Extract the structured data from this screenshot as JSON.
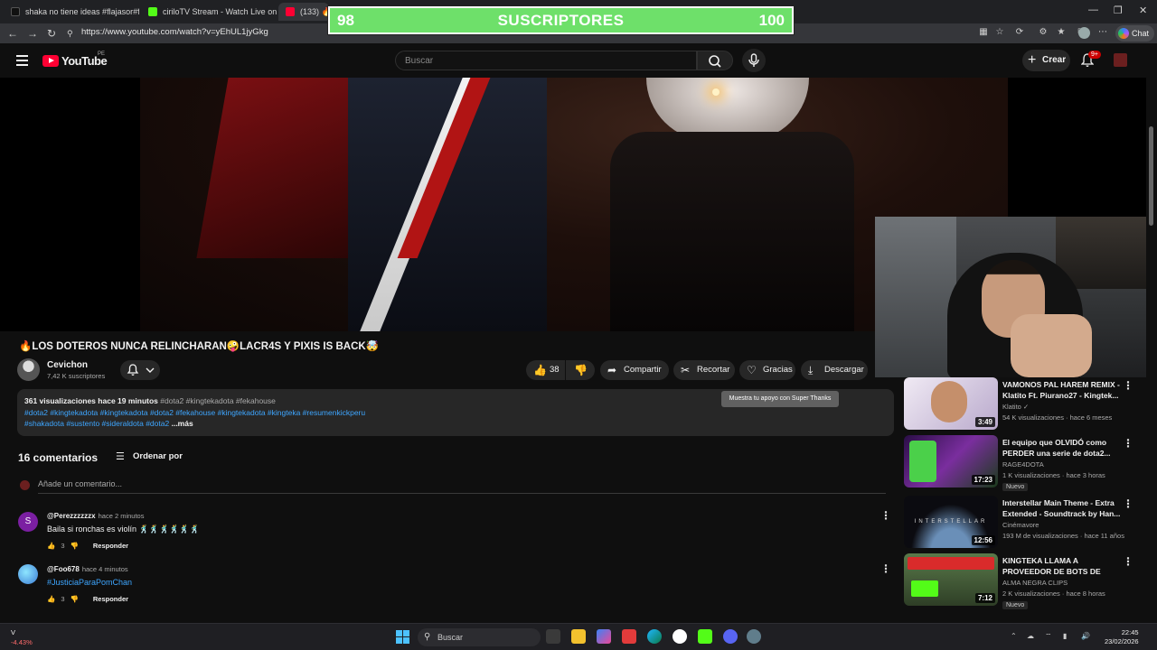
{
  "browser": {
    "tabs": [
      {
        "label": "shaka no tiene ideas #flajasor#fek",
        "color": "#000000"
      },
      {
        "label": "ciriloTV Stream - Watch Live on Ki",
        "color": "#53fc18"
      },
      {
        "label": "(133) 🔥LO",
        "color": "#ff0033"
      }
    ],
    "url": "https://www.youtube.com/watch?v=yEhUL1jyGkg",
    "chat_label": "Chat"
  },
  "sub_overlay": {
    "current": "98",
    "label": "SUSCRIPTORES",
    "goal": "100"
  },
  "youtube_header": {
    "logo_text": "YouTube",
    "region": "PE",
    "search_placeholder": "Buscar",
    "create_label": "Crear",
    "notif_count": "9+"
  },
  "video": {
    "title": "🔥LOS DOTEROS NUNCA RELINCHARAN🤪LACR4S Y PIXIS IS BACK🤯",
    "channel_name": "Cevichon",
    "channel_subs": "7,42 K suscriptores",
    "likes": "38",
    "actions": {
      "share": "Compartir",
      "clip": "Recortar",
      "thanks": "Gracias",
      "download": "Descargar"
    },
    "tooltip": "Muestra tu apoyo con Super Thanks"
  },
  "description": {
    "views": "361 visualizaciones",
    "time": "hace 19 minutos",
    "top_tags": "#dota2 #kingtekadota #fekahouse",
    "line2": "#dota2 #kingtekadota #kingtekadota #dota2 #fekahouse #kingtekadota #kingteka  #resumenkickperu",
    "line3": "#shakadota #sustento #sideraldota #dota2",
    "more": "...más"
  },
  "comments": {
    "count_label": "16 comentarios",
    "sort_label": "Ordenar por",
    "add_placeholder": "Añade un comentario...",
    "items": [
      {
        "initial": "S",
        "author": "@Perezzzzzzx",
        "time": "hace 2 minutos",
        "text": "Baila si ronchas es violín 🕺🕺🕺🕺🕺🕺",
        "likes": "3",
        "reply": "Responder",
        "avatar_color": "#7b1fa2"
      },
      {
        "initial": "",
        "author": "@Foo678",
        "time": "hace 4 minutos",
        "text": "#JusticiaParaPomChan",
        "likes": "3",
        "reply": "Responder",
        "avatar_color": "#4fc3f7"
      }
    ]
  },
  "recommendations": [
    {
      "title": "VAMONOS PAL HAREM REMIX - Klatito Ft. Piurano27 - Kingtek...",
      "channel": "Klatito ✓",
      "meta": "54 K visualizaciones · hace 6 meses",
      "duration": "3:49",
      "badge": "",
      "thumb": "#e9e3ee"
    },
    {
      "title": "El equipo que OLVIDÓ como PERDER una serie de dota2...",
      "channel": "RAGE4DOTA",
      "meta": "1 K visualizaciones · hace 3 horas",
      "duration": "17:23",
      "badge": "Nuevo",
      "thumb": "#5a2a8a"
    },
    {
      "title": "Interstellar Main Theme - Extra Extended - Soundtrack by  Han...",
      "channel": "Cinémavore",
      "meta": "193 M de visualizaciones · hace 11 años",
      "duration": "12:56",
      "badge": "",
      "thumb": "#0b0b10"
    },
    {
      "title": "KINGTEKA LLAMA A PROVEEDOR DE BOTS DE KIC...",
      "channel": "ALMA NEGRA CLIPS",
      "meta": "2 K visualizaciones · hace 8 horas",
      "duration": "7:12",
      "badge": "Nuevo",
      "thumb": "#4a6b3a"
    }
  ],
  "taskbar": {
    "stock_label": "V",
    "stock_change": "-4.43%",
    "search_label": "Buscar",
    "time": "22:45",
    "date": "23/02/2026"
  }
}
